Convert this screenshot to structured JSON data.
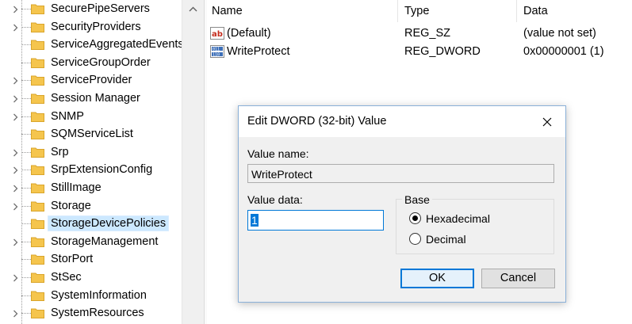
{
  "tree": {
    "items": [
      {
        "label": "SecurePipeServers",
        "expandable": true
      },
      {
        "label": "SecurityProviders",
        "expandable": true
      },
      {
        "label": "ServiceAggregatedEvents",
        "expandable": false
      },
      {
        "label": "ServiceGroupOrder",
        "expandable": false
      },
      {
        "label": "ServiceProvider",
        "expandable": true
      },
      {
        "label": "Session Manager",
        "expandable": true
      },
      {
        "label": "SNMP",
        "expandable": true
      },
      {
        "label": "SQMServiceList",
        "expandable": false
      },
      {
        "label": "Srp",
        "expandable": true
      },
      {
        "label": "SrpExtensionConfig",
        "expandable": true
      },
      {
        "label": "StillImage",
        "expandable": true
      },
      {
        "label": "Storage",
        "expandable": true
      },
      {
        "label": "StorageDevicePolicies",
        "expandable": false,
        "selected": true
      },
      {
        "label": "StorageManagement",
        "expandable": true
      },
      {
        "label": "StorPort",
        "expandable": false
      },
      {
        "label": "StSec",
        "expandable": true
      },
      {
        "label": "SystemInformation",
        "expandable": false
      },
      {
        "label": "SystemResources",
        "expandable": true
      }
    ]
  },
  "list": {
    "columns": [
      "Name",
      "Type",
      "Data"
    ],
    "rows": [
      {
        "icon": "string-value-icon",
        "name": "(Default)",
        "type": "REG_SZ",
        "data": "(value not set)"
      },
      {
        "icon": "binary-value-icon",
        "name": "WriteProtect",
        "type": "REG_DWORD",
        "data": "0x00000001 (1)"
      }
    ]
  },
  "dialog": {
    "title": "Edit DWORD (32-bit) Value",
    "value_name_label": "Value name:",
    "value_name": "WriteProtect",
    "value_data_label": "Value data:",
    "value_data": "1",
    "base_label": "Base",
    "radio_hex": "Hexadecimal",
    "radio_dec": "Decimal",
    "base_selected": "Hexadecimal",
    "ok_label": "OK",
    "cancel_label": "Cancel"
  },
  "colors": {
    "folder": "#f5c54d",
    "selection": "#cce8ff",
    "accent": "#0078d7",
    "dialog_bg": "#f0f0f0"
  }
}
